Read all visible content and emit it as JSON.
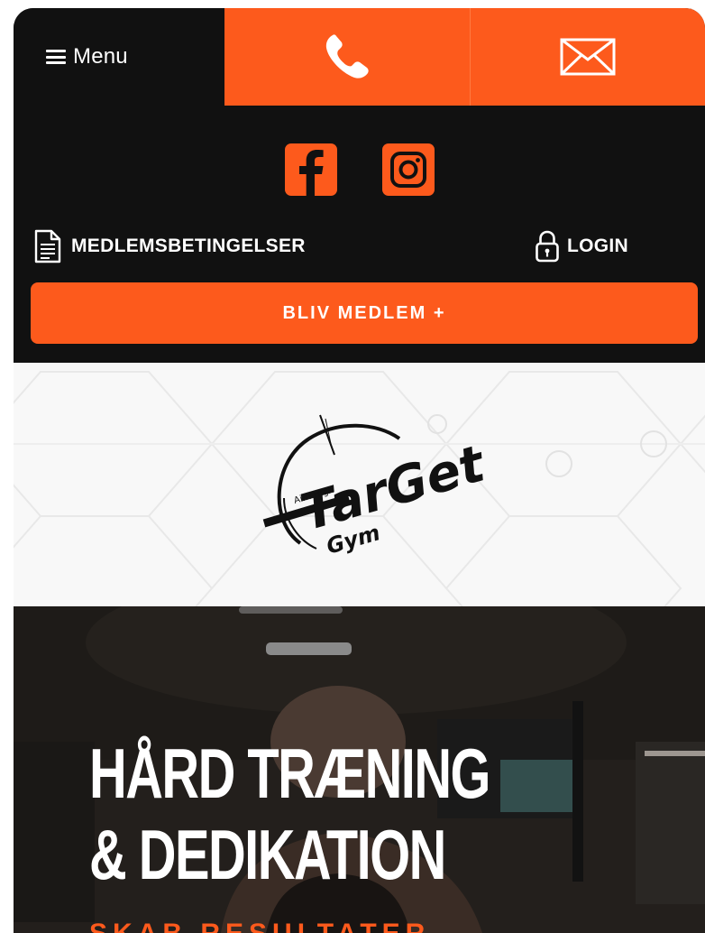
{
  "header": {
    "menu_label": "Menu",
    "icons": {
      "menu": "hamburger-icon",
      "phone": "phone-icon",
      "mail": "mail-icon"
    }
  },
  "social": {
    "items": [
      {
        "name": "facebook",
        "icon": "facebook-icon"
      },
      {
        "name": "instagram",
        "icon": "instagram-icon"
      }
    ]
  },
  "links": {
    "terms_label": "MEDLEMSBETINGELSER",
    "login_label": "LOGIN"
  },
  "cta": {
    "label": "BLIV MEDLEM +"
  },
  "logo": {
    "tagline": "Aim High",
    "brand": "TarGet",
    "sub": "Gym"
  },
  "hero": {
    "title_line1": "HÅRD TRÆNING",
    "title_line2": "& DEDIKATION",
    "subtitle": "SKAB RESULTATER"
  },
  "colors": {
    "accent": "#fd5a1c",
    "dark": "#111111",
    "light": "#f8f8f8"
  }
}
